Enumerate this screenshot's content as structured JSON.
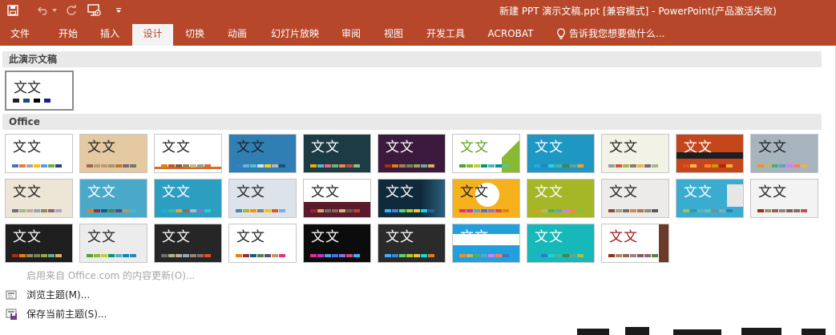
{
  "title_bar": {
    "title": "新建 PPT 演示文稿.ppt [兼容模式] - PowerPoint(产品激活失败)",
    "background": "#b7472a",
    "quick_access": [
      "save-icon",
      "undo-icon",
      "redo-icon",
      "slideshow-from-start-icon",
      "customize-dropdown-icon"
    ]
  },
  "ribbon": {
    "tabs": [
      {
        "label": "文件"
      },
      {
        "label": "开始"
      },
      {
        "label": "插入"
      },
      {
        "label": "设计",
        "active": true
      },
      {
        "label": "切换"
      },
      {
        "label": "动画"
      },
      {
        "label": "幻灯片放映"
      },
      {
        "label": "审阅"
      },
      {
        "label": "视图"
      },
      {
        "label": "开发工具"
      },
      {
        "label": "ACROBAT"
      }
    ],
    "tell_me": "告诉我您想要做什么..."
  },
  "gallery": {
    "current_header": "此演示文稿",
    "office_header": "Office",
    "current_theme": {
      "text": "文文",
      "swatches": [
        "#ffffff",
        "#1f1f1f",
        "#eeece1",
        "#1f497d",
        "#ffffff",
        "#000000",
        "#c0c0c0",
        "#1f1f8a"
      ]
    },
    "themes": [
      {
        "text": "文文",
        "bg": "#ffffff",
        "fg": "#222222",
        "swatches": [
          "#4472c4",
          "#ed7d31",
          "#a5a5a5",
          "#ffc000",
          "#5b9bd5",
          "#70ad47",
          "#264478"
        ]
      },
      {
        "text": "文文",
        "bg": "#e4c9a2",
        "fg": "#222222",
        "swatches": [
          "#a5644e",
          "#b09f74",
          "#c3986d",
          "#a19574",
          "#c17529",
          "#826277",
          "#6b7b6e"
        ]
      },
      {
        "text": "文文",
        "bg": "#ffffff",
        "fg": "#222222",
        "swatches": [
          "#e48312",
          "#bd582c",
          "#865640",
          "#9b8357",
          "#c2bc80",
          "#94a088",
          "#d46e2b"
        ]
      },
      {
        "text": "文文",
        "bg": "#2f7fb5",
        "fg": "#222222",
        "swatches": [
          "#2d83c3",
          "#6bb0e0",
          "#4dc7c9",
          "#d5e3ec",
          "#ffcf25",
          "#b8b8b8",
          "#1d4f73"
        ]
      },
      {
        "text": "文文",
        "bg": "#1d3b45",
        "fg": "#ffffff",
        "swatches": [
          "#f0ad00",
          "#60b5cc",
          "#e66c7d",
          "#6bb76d",
          "#e88651",
          "#c64847",
          "#89c17c"
        ]
      },
      {
        "text": "文文",
        "bg": "#3b1a3e",
        "fg": "#ffffff",
        "swatches": [
          "#a53010",
          "#de7e18",
          "#9f8351",
          "#728653",
          "#92aa4c",
          "#6aac91",
          "#d8b25c"
        ]
      },
      {
        "text": "文文",
        "bg": "#ffffff",
        "fg": "#60a220",
        "swatches": [
          "#549e39",
          "#8ab833",
          "#c0cf3a",
          "#029676",
          "#4ab5c4",
          "#0989b1",
          "#5ec29a"
        ]
      },
      {
        "text": "文文",
        "bg": "#1f97c3",
        "fg": "#ffffff",
        "swatches": [
          "#1cade4",
          "#2683c6",
          "#27ced7",
          "#42ba97",
          "#3e8853",
          "#62a39f",
          "#f0a22e"
        ]
      },
      {
        "text": "文文",
        "bg": "#f2f2e6",
        "fg": "#222222",
        "swatches": [
          "#93a299",
          "#cf543f",
          "#b5ae53",
          "#848058",
          "#e8b54d",
          "#786c71",
          "#a5b592"
        ]
      },
      {
        "text": "文文",
        "bg": "#c4461a",
        "fg": "#ffffff",
        "swatches": [
          "#e84c22",
          "#ffbd47",
          "#b64926",
          "#ff8427",
          "#cc9900",
          "#b22600",
          "#f3b13c"
        ]
      },
      {
        "text": "文文",
        "bg": "#a7b4be",
        "fg": "#222222",
        "swatches": [
          "#f09415",
          "#c1b56b",
          "#4baf73",
          "#5aa6c0",
          "#d17df9",
          "#fa7e5c",
          "#e8b54d"
        ]
      },
      {
        "text": "文文",
        "bg": "#ede6d6",
        "fg": "#222222",
        "swatches": [
          "#6f6f74",
          "#a7b789",
          "#beae98",
          "#92a9b9",
          "#9c8265",
          "#8d6974",
          "#b1a2ce"
        ]
      },
      {
        "text": "文文",
        "bg": "#4aa9c8",
        "fg": "#ffffff",
        "swatches": [
          "#f07f09",
          "#9f2936",
          "#1b587c",
          "#4e8542",
          "#604878",
          "#c19859",
          "#42b8d4"
        ]
      },
      {
        "text": "文文",
        "bg": "#2c9ec0",
        "fg": "#ffffff",
        "swatches": [
          "#1cade4",
          "#42ba97",
          "#f0a22e",
          "#a5644e",
          "#b8b8b8",
          "#8f6fd6",
          "#27ced7"
        ]
      },
      {
        "text": "文文",
        "bg": "#dde3ea",
        "fg": "#222222",
        "swatches": [
          "#418ab3",
          "#a6b727",
          "#f69200",
          "#838383",
          "#fec306",
          "#df5327",
          "#6cb6e2"
        ]
      },
      {
        "text": "文文",
        "bg": "#ffffff",
        "fg": "#222222",
        "swatches": [
          "#9d2235",
          "#e0a85f",
          "#6f6f74",
          "#8c6b44",
          "#c2bc80",
          "#6a5a3f",
          "#b64926"
        ]
      },
      {
        "text": "文文",
        "bg": "#0f2a3b",
        "fg": "#ffffff",
        "swatches": [
          "#31b6fd",
          "#4584d3",
          "#5bd078",
          "#a5d028",
          "#f5c040",
          "#05e0db",
          "#2c5f9d"
        ]
      },
      {
        "text": "文文",
        "bg": "#f5b21c",
        "fg": "#222222",
        "swatches": [
          "#e32d91",
          "#c830cc",
          "#4ea6dc",
          "#4775e7",
          "#8971e1",
          "#d54773",
          "#ee7b08"
        ]
      },
      {
        "text": "文文",
        "bg": "#a5b726",
        "fg": "#ffffff",
        "swatches": [
          "#f09415",
          "#c1b56b",
          "#4baf73",
          "#5aa6c0",
          "#d17df9",
          "#fa7e5c",
          "#7cc244"
        ]
      },
      {
        "text": "文文",
        "bg": "#ecebea",
        "fg": "#222222",
        "swatches": [
          "#8a4a3c",
          "#a7a37e",
          "#6f6f74",
          "#cc8a55",
          "#c06e52",
          "#8e8a74",
          "#595959"
        ]
      },
      {
        "text": "文文",
        "bg": "#3aaccf",
        "fg": "#ffffff",
        "swatches": [
          "#a5c249",
          "#3494ba",
          "#58b6c0",
          "#75bda7",
          "#7a8c8e",
          "#84acb6",
          "#2683c6"
        ]
      },
      {
        "text": "文文",
        "bg": "#f3f3f3",
        "fg": "#222222",
        "swatches": [
          "#9b2d1f",
          "#a28e6a",
          "#956251",
          "#918485",
          "#855d5d",
          "#8d6974",
          "#c0504d"
        ]
      },
      {
        "text": "文文",
        "bg": "#1f1f1f",
        "fg": "#ffffff",
        "swatches": [
          "#a53010",
          "#de7e18",
          "#9f8351",
          "#728653",
          "#92aa4c",
          "#6aac91",
          "#d8b25c"
        ]
      },
      {
        "text": "文文",
        "bg": "#ececec",
        "fg": "#222222",
        "swatches": [
          "#549e39",
          "#8ab833",
          "#c0cf3a",
          "#029676",
          "#4ab5c4",
          "#0989b1",
          "#2d83c3"
        ]
      },
      {
        "text": "文文",
        "bg": "#262626",
        "fg": "#ffffff",
        "swatches": [
          "#6f6f74",
          "#a7b789",
          "#beae98",
          "#92a9b9",
          "#9c8265",
          "#8d6974",
          "#e84c22"
        ]
      },
      {
        "text": "文文",
        "bg": "#ffffff",
        "fg": "#222222",
        "swatches": [
          "#f07f09",
          "#9f2936",
          "#1b587c",
          "#4e8542",
          "#604878",
          "#c19859",
          "#e32d91"
        ]
      },
      {
        "text": "文文",
        "bg": "#0c0c0c",
        "fg": "#ffffff",
        "swatches": [
          "#e32d91",
          "#c830cc",
          "#4ea6dc",
          "#4775e7",
          "#8971e1",
          "#d54773",
          "#31b6fd"
        ]
      },
      {
        "text": "文文",
        "bg": "#2b2b2b",
        "fg": "#ffffff",
        "swatches": [
          "#31b6fd",
          "#4584d3",
          "#5bd078",
          "#a5d028",
          "#f5c040",
          "#05e0db",
          "#de7e18"
        ]
      },
      {
        "text": "文文",
        "bg": "#22a0dc",
        "fg": "#ffffff",
        "swatches": [
          "#f09415",
          "#c1b56b",
          "#4baf73",
          "#5aa6c0",
          "#d17df9",
          "#fa7e5c",
          "#4472c4"
        ]
      },
      {
        "text": "文文",
        "bg": "#17b8b8",
        "fg": "#ffffff",
        "swatches": [
          "#1cade4",
          "#2683c6",
          "#27ced7",
          "#42ba97",
          "#3e8853",
          "#62a39f",
          "#a5c249"
        ]
      },
      {
        "text": "文文",
        "bg": "#ffffff",
        "fg": "#9b1c1c",
        "swatches": [
          "#9b2d1f",
          "#a28e6a",
          "#956251",
          "#918485",
          "#855d5d",
          "#8d6974",
          "#4e8542"
        ]
      }
    ]
  },
  "menu": {
    "update_from_office": "启用来自 Office.com 的内容更新(O)...",
    "browse_themes": "浏览主题(M)...",
    "save_current_theme": "保存当前主题(S)..."
  }
}
